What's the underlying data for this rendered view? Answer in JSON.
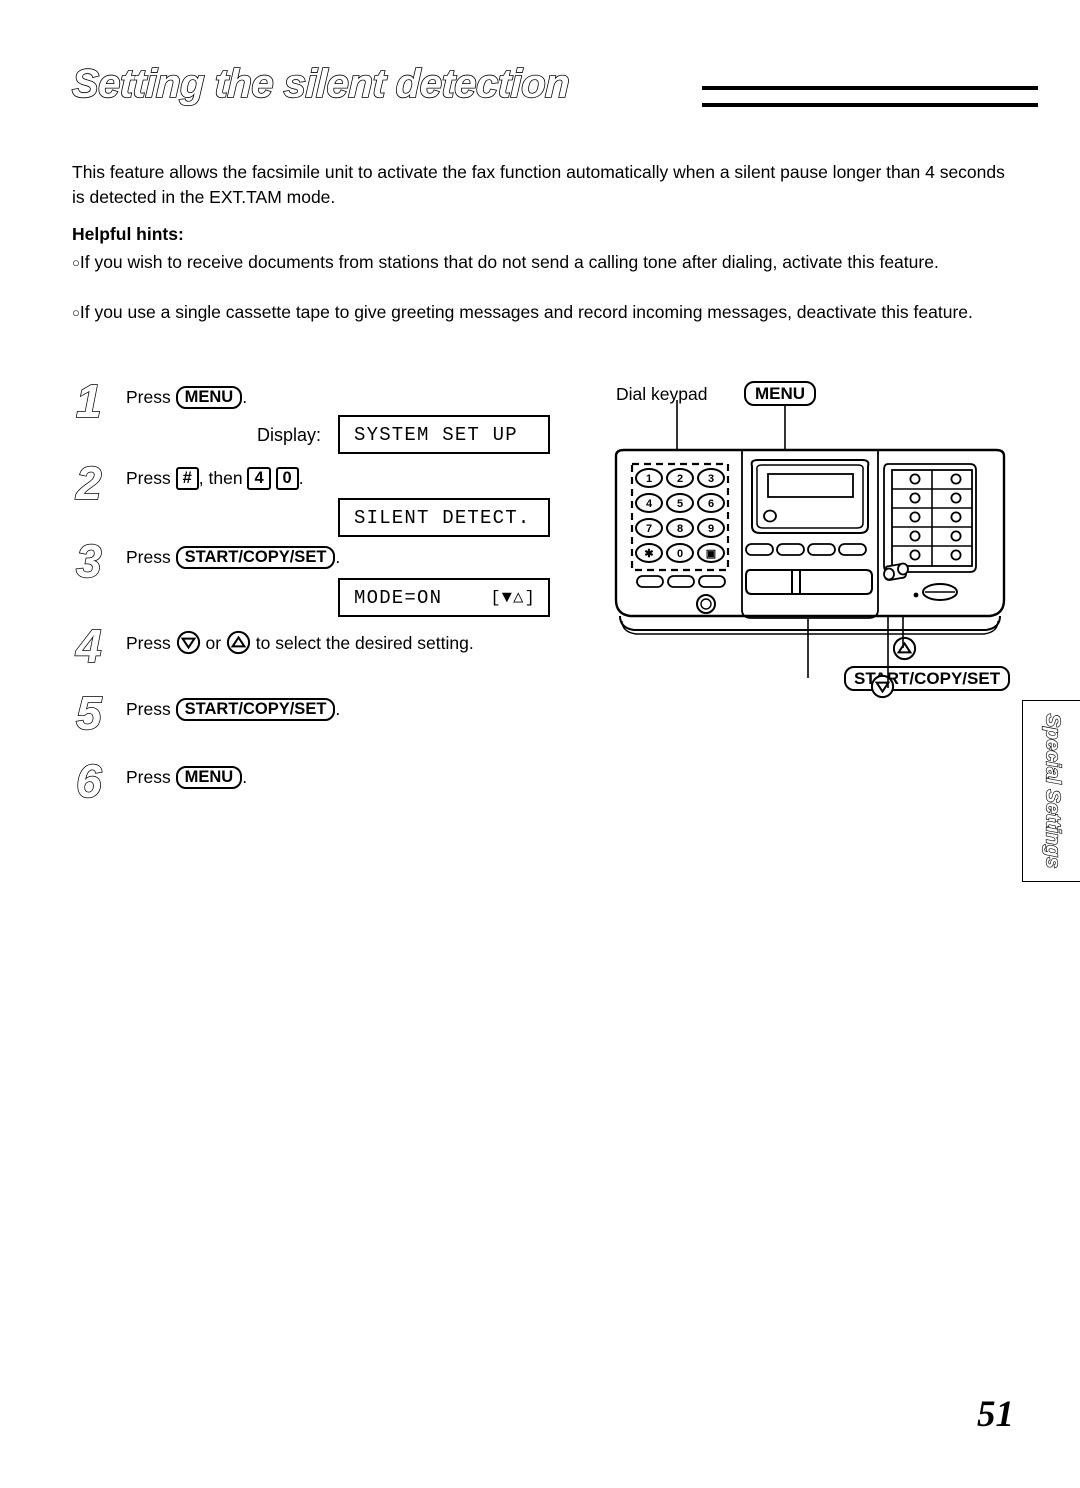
{
  "title": "Setting the silent detection",
  "intro": "This feature allows the facsimile unit to activate the fax function automatically when a silent pause longer than 4 seconds is detected in the EXT.TAM mode.",
  "hints_heading": "Helpful hints:",
  "hints": [
    "If you wish to receive documents from stations that do not send a calling tone after dialing, activate this feature.",
    "If you use a single cassette tape to give greeting messages and record incoming messages, deactivate this feature."
  ],
  "bullet_char": "○",
  "steps": [
    {
      "number": "1",
      "press_word": "Press",
      "keys": [
        "MENU"
      ],
      "trailing": ".",
      "display_label": "Display:",
      "lcd": "SYSTEM SET UP"
    },
    {
      "number": "2",
      "press_word": "Press",
      "keys": [
        "#",
        "4",
        "0"
      ],
      "then_word": ", then",
      "trailing": ".",
      "lcd": "SILENT DETECT."
    },
    {
      "number": "3",
      "press_word": "Press",
      "keys": [
        "START/COPY/SET"
      ],
      "trailing": ".",
      "lcd_left": "MODE=ON",
      "lcd_right": "[▼△]"
    },
    {
      "number": "4",
      "press_word": "Press",
      "or_word": "or",
      "tail_text": "to select the desired setting."
    },
    {
      "number": "5",
      "press_word": "Press",
      "keys": [
        "START/COPY/SET"
      ],
      "trailing": "."
    },
    {
      "number": "6",
      "press_word": "Press",
      "keys": [
        "MENU"
      ],
      "trailing": "."
    }
  ],
  "machine": {
    "callout_dial_keypad": "Dial keypad",
    "callout_menu": "MENU",
    "callout_start": "START/COPY/SET",
    "keypad_rows": [
      [
        "1",
        "2",
        "3"
      ],
      [
        "4",
        "5",
        "6"
      ],
      [
        "7",
        "8",
        "9"
      ],
      [
        "∗",
        "0",
        "■"
      ]
    ]
  },
  "side_tab": "Special Settings",
  "page_number": "51"
}
